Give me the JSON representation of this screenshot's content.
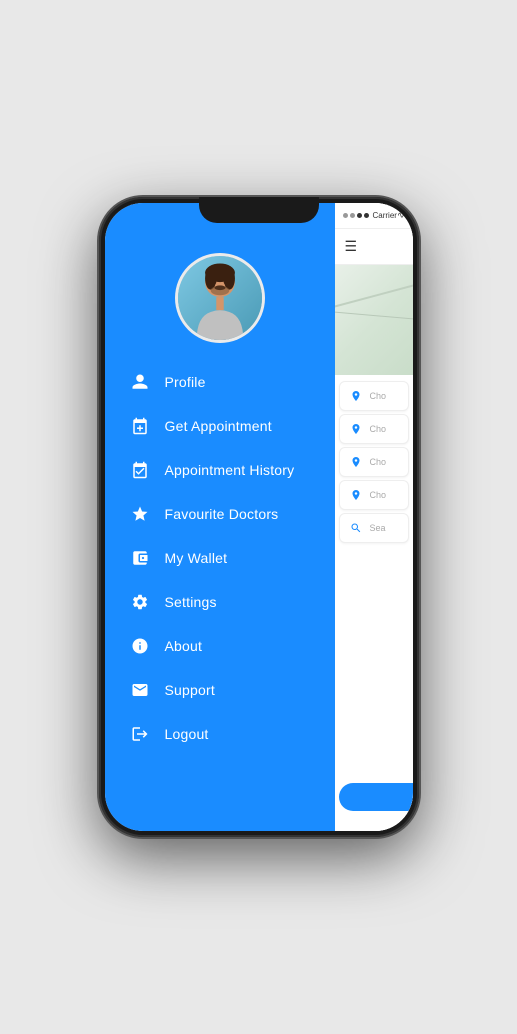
{
  "phone": {
    "status_bar": {
      "carrier": "Carrier",
      "wifi": "wifi"
    }
  },
  "sidebar": {
    "menu_items": [
      {
        "id": "profile",
        "label": "Profile",
        "icon": "person"
      },
      {
        "id": "get-appointment",
        "label": "Get Appointment",
        "icon": "calendar-plus"
      },
      {
        "id": "appointment-history",
        "label": "Appointment History",
        "icon": "calendar-check"
      },
      {
        "id": "favourite-doctors",
        "label": "Favourite Doctors",
        "icon": "star"
      },
      {
        "id": "my-wallet",
        "label": "My Wallet",
        "icon": "wallet"
      },
      {
        "id": "settings",
        "label": "Settings",
        "icon": "gear"
      },
      {
        "id": "about",
        "label": "About",
        "icon": "info"
      },
      {
        "id": "support",
        "label": "Support",
        "icon": "envelope"
      },
      {
        "id": "logout",
        "label": "Logout",
        "icon": "logout"
      }
    ]
  },
  "right_panel": {
    "status": {
      "carrier": "Carrier",
      "signal": "partial",
      "wifi": true
    },
    "header": {
      "hamburger": "☰"
    },
    "search_options": [
      {
        "icon": "person-location",
        "placeholder": "Cho"
      },
      {
        "icon": "location-pin",
        "placeholder": "Cho"
      },
      {
        "icon": "location-pin",
        "placeholder": "Cho"
      },
      {
        "icon": "person-medical",
        "placeholder": "Cho"
      },
      {
        "icon": "search-person",
        "placeholder": "Sea"
      }
    ],
    "accent_color": "#1a8cff"
  }
}
